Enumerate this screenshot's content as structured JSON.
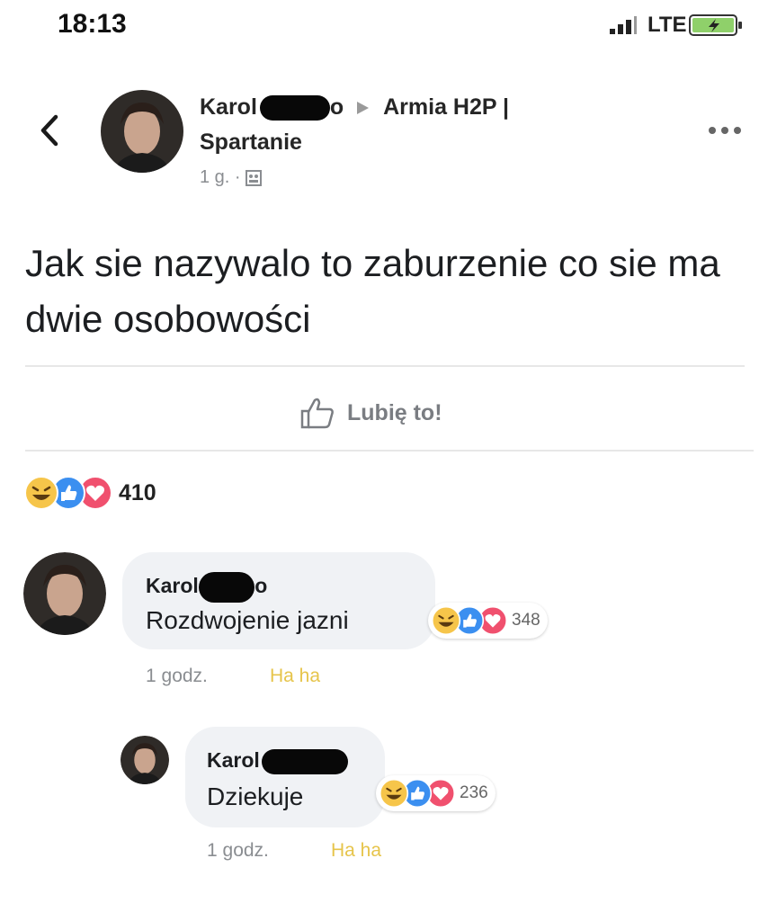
{
  "status_bar": {
    "time": "18:13",
    "network": "LTE"
  },
  "post": {
    "author": "Karol",
    "author_suffix": "o",
    "group_line1": "Armia H2P |",
    "group_line2": "Spartanie",
    "time": "1 g. ·",
    "text": "Jak sie nazywalo to zaburzenie co sie ma dwie osobowości",
    "like_label": "Lubię to!",
    "reaction_count": "410"
  },
  "comments": [
    {
      "author": "Karol",
      "author_suffix": "o",
      "text": "Rozdwojenie jazni",
      "reaction_count": "348",
      "time": "1 godz.",
      "action": "Ha ha"
    },
    {
      "author": "Karol",
      "text": "Dziekuje",
      "reaction_count": "236",
      "time": "1 godz.",
      "action": "Ha ha"
    }
  ],
  "icons": [
    "back-chevron-icon",
    "more-options-icon",
    "public-group-icon",
    "like-thumb-icon",
    "haha-reaction-icon",
    "like-reaction-icon",
    "love-reaction-icon",
    "signal-icon",
    "battery-icon"
  ],
  "colors": {
    "haha": "#f6c54a",
    "like": "#3b8ff0",
    "love": "#f0506e",
    "meta_gray": "#8a8d91"
  }
}
